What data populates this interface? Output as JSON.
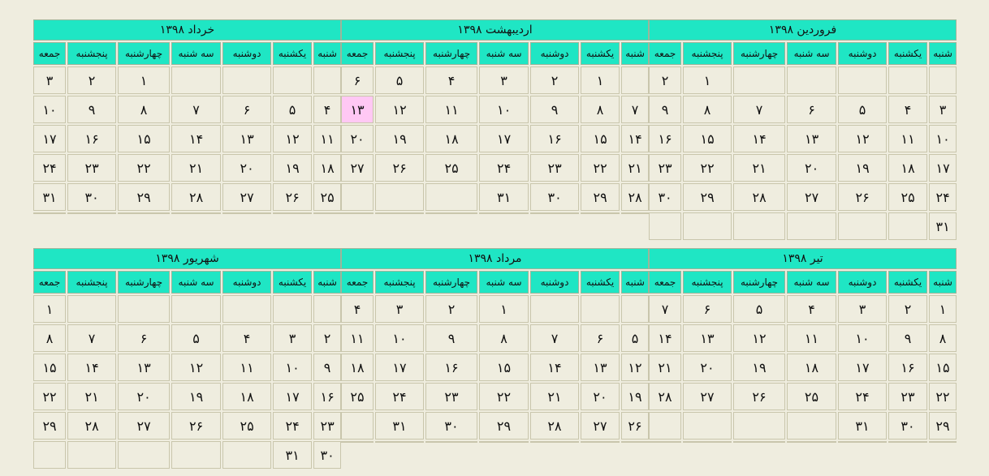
{
  "weekdays": [
    "شنبه",
    "یکشنبه",
    "دوشنبه",
    "سه شنبه",
    "چهارشنبه",
    "پنجشنبه",
    "جمعه"
  ],
  "months": [
    {
      "title": "فروردین ۱۳۹۸",
      "weeks": [
        [
          "",
          "",
          "",
          "",
          "",
          "۱",
          "۲"
        ],
        [
          "۳",
          "۴",
          "۵",
          "۶",
          "۷",
          "۸",
          "۹"
        ],
        [
          "۱۰",
          "۱۱",
          "۱۲",
          "۱۳",
          "۱۴",
          "۱۵",
          "۱۶"
        ],
        [
          "۱۷",
          "۱۸",
          "۱۹",
          "۲۰",
          "۲۱",
          "۲۲",
          "۲۳"
        ],
        [
          "۲۴",
          "۲۵",
          "۲۶",
          "۲۷",
          "۲۸",
          "۲۹",
          "۳۰"
        ],
        [
          "۳۱",
          "",
          "",
          "",
          "",
          "",
          ""
        ]
      ]
    },
    {
      "title": "اردیبهشت ۱۳۹۸",
      "today": "۱۳",
      "weeks": [
        [
          "",
          "۱",
          "۲",
          "۳",
          "۴",
          "۵",
          "۶"
        ],
        [
          "۷",
          "۸",
          "۹",
          "۱۰",
          "۱۱",
          "۱۲",
          "۱۳"
        ],
        [
          "۱۴",
          "۱۵",
          "۱۶",
          "۱۷",
          "۱۸",
          "۱۹",
          "۲۰"
        ],
        [
          "۲۱",
          "۲۲",
          "۲۳",
          "۲۴",
          "۲۵",
          "۲۶",
          "۲۷"
        ],
        [
          "۲۸",
          "۲۹",
          "۳۰",
          "۳۱",
          "",
          "",
          ""
        ]
      ]
    },
    {
      "title": "خرداد ۱۳۹۸",
      "weeks": [
        [
          "",
          "",
          "",
          "",
          "۱",
          "۲",
          "۳"
        ],
        [
          "۴",
          "۵",
          "۶",
          "۷",
          "۸",
          "۹",
          "۱۰"
        ],
        [
          "۱۱",
          "۱۲",
          "۱۳",
          "۱۴",
          "۱۵",
          "۱۶",
          "۱۷"
        ],
        [
          "۱۸",
          "۱۹",
          "۲۰",
          "۲۱",
          "۲۲",
          "۲۳",
          "۲۴"
        ],
        [
          "۲۵",
          "۲۶",
          "۲۷",
          "۲۸",
          "۲۹",
          "۳۰",
          "۳۱"
        ]
      ]
    },
    {
      "title": "تیر ۱۳۹۸",
      "weeks": [
        [
          "۱",
          "۲",
          "۳",
          "۴",
          "۵",
          "۶",
          "۷"
        ],
        [
          "۸",
          "۹",
          "۱۰",
          "۱۱",
          "۱۲",
          "۱۳",
          "۱۴"
        ],
        [
          "۱۵",
          "۱۶",
          "۱۷",
          "۱۸",
          "۱۹",
          "۲۰",
          "۲۱"
        ],
        [
          "۲۲",
          "۲۳",
          "۲۴",
          "۲۵",
          "۲۶",
          "۲۷",
          "۲۸"
        ],
        [
          "۲۹",
          "۳۰",
          "۳۱",
          "",
          "",
          "",
          ""
        ]
      ]
    },
    {
      "title": "مرداد ۱۳۹۸",
      "weeks": [
        [
          "",
          "",
          "",
          "۱",
          "۲",
          "۳",
          "۴"
        ],
        [
          "۵",
          "۶",
          "۷",
          "۸",
          "۹",
          "۱۰",
          "۱۱"
        ],
        [
          "۱۲",
          "۱۳",
          "۱۴",
          "۱۵",
          "۱۶",
          "۱۷",
          "۱۸"
        ],
        [
          "۱۹",
          "۲۰",
          "۲۱",
          "۲۲",
          "۲۳",
          "۲۴",
          "۲۵"
        ],
        [
          "۲۶",
          "۲۷",
          "۲۸",
          "۲۹",
          "۳۰",
          "۳۱",
          ""
        ]
      ]
    },
    {
      "title": "شهریور ۱۳۹۸",
      "weeks": [
        [
          "",
          "",
          "",
          "",
          "",
          "",
          "۱"
        ],
        [
          "۲",
          "۳",
          "۴",
          "۵",
          "۶",
          "۷",
          "۸"
        ],
        [
          "۹",
          "۱۰",
          "۱۱",
          "۱۲",
          "۱۳",
          "۱۴",
          "۱۵"
        ],
        [
          "۱۶",
          "۱۷",
          "۱۸",
          "۱۹",
          "۲۰",
          "۲۱",
          "۲۲"
        ],
        [
          "۲۳",
          "۲۴",
          "۲۵",
          "۲۶",
          "۲۷",
          "۲۸",
          "۲۹"
        ],
        [
          "۳۰",
          "۳۱",
          "",
          "",
          "",
          "",
          ""
        ]
      ]
    }
  ]
}
